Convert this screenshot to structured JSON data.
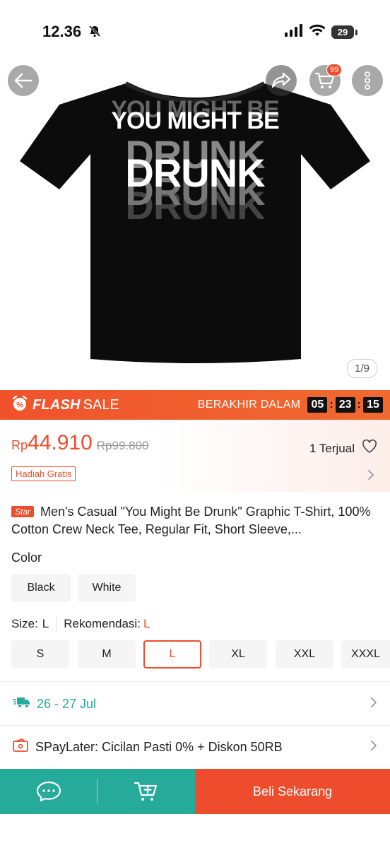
{
  "status_bar": {
    "time": "12.36",
    "battery": "29"
  },
  "header": {
    "cart_count": "99"
  },
  "product_image": {
    "shirt_line1": "YOU MIGHT BE",
    "shirt_line2": "DRUNK",
    "counter": "1/9"
  },
  "flash_sale": {
    "title_bold": "FLASH",
    "title_rest": "SALE",
    "ends_label": "BERAKHIR DALAM",
    "hours": "05",
    "minutes": "23",
    "seconds": "15"
  },
  "price": {
    "currency": "Rp",
    "current": "44.910",
    "original": "Rp99.800",
    "sold": "1 Terjual",
    "gift_badge": "Hadiah Gratis"
  },
  "product": {
    "badge": "Star",
    "title": "Men's Casual \"You Might Be Drunk\" Graphic T-Shirt, 100% Cotton Crew Neck Tee, Regular Fit, Short Sleeve,..."
  },
  "variations": {
    "color_label": "Color",
    "colors": [
      "Black",
      "White"
    ],
    "size_label": "Size:",
    "size_value": "L",
    "rec_label": "Rekomendasi:",
    "rec_value": "L",
    "sizes": [
      "S",
      "M",
      "L",
      "XL",
      "XXL",
      "XXXL"
    ],
    "selected_size": "L"
  },
  "shipping": {
    "date": "26 - 27 Jul"
  },
  "paylater": {
    "text": "SPayLater: Cicilan Pasti 0% + Diskon 50RB"
  },
  "bottom_bar": {
    "buy_label": "Beli Sekarang"
  },
  "colors": {
    "accent": "#ee4d2d",
    "teal": "#26aa99"
  }
}
